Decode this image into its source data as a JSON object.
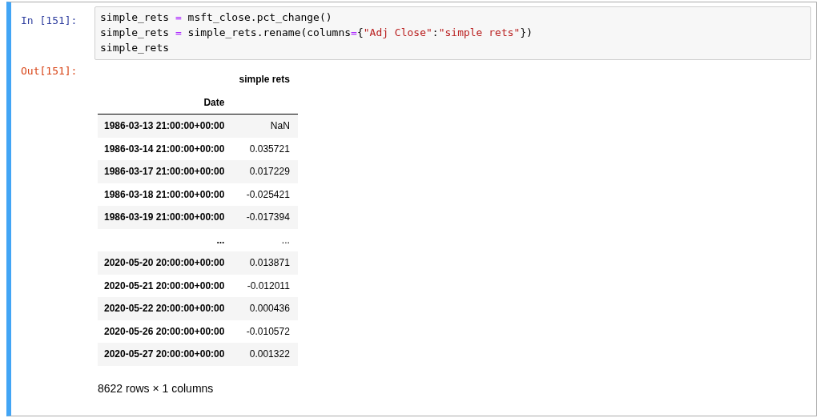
{
  "cell": {
    "selected": true,
    "input_prompt": "In  [151]:",
    "code_lines": [
      [
        {
          "text": "simple_rets ",
          "kind": "name"
        },
        {
          "text": "=",
          "kind": "op"
        },
        {
          "text": " msft_close.pct_change()",
          "kind": "name"
        }
      ],
      [
        {
          "text": "simple_rets ",
          "kind": "name"
        },
        {
          "text": "=",
          "kind": "op"
        },
        {
          "text": " simple_rets.rename(columns",
          "kind": "name"
        },
        {
          "text": "=",
          "kind": "op"
        },
        {
          "text": "{",
          "kind": "name"
        },
        {
          "text": "\"Adj Close\"",
          "kind": "string"
        },
        {
          "text": ":",
          "kind": "name"
        },
        {
          "text": "\"simple rets\"",
          "kind": "string"
        },
        {
          "text": "})",
          "kind": "name"
        }
      ],
      [
        {
          "text": "simple_rets",
          "kind": "name"
        }
      ]
    ],
    "output_prompt": "Out[151]:",
    "table": {
      "column": "simple rets",
      "index_name": "Date",
      "rows": [
        {
          "index": "1986-03-13 21:00:00+00:00",
          "value": "NaN"
        },
        {
          "index": "1986-03-14 21:00:00+00:00",
          "value": "0.035721"
        },
        {
          "index": "1986-03-17 21:00:00+00:00",
          "value": "0.017229"
        },
        {
          "index": "1986-03-18 21:00:00+00:00",
          "value": "-0.025421"
        },
        {
          "index": "1986-03-19 21:00:00+00:00",
          "value": "-0.017394"
        },
        {
          "index": "...",
          "value": "..."
        },
        {
          "index": "2020-05-20 20:00:00+00:00",
          "value": "0.013871"
        },
        {
          "index": "2020-05-21 20:00:00+00:00",
          "value": "-0.012011"
        },
        {
          "index": "2020-05-22 20:00:00+00:00",
          "value": "0.000436"
        },
        {
          "index": "2020-05-26 20:00:00+00:00",
          "value": "-0.010572"
        },
        {
          "index": "2020-05-27 20:00:00+00:00",
          "value": "0.001322"
        }
      ]
    },
    "shape_note": "8622 rows × 1 columns"
  }
}
